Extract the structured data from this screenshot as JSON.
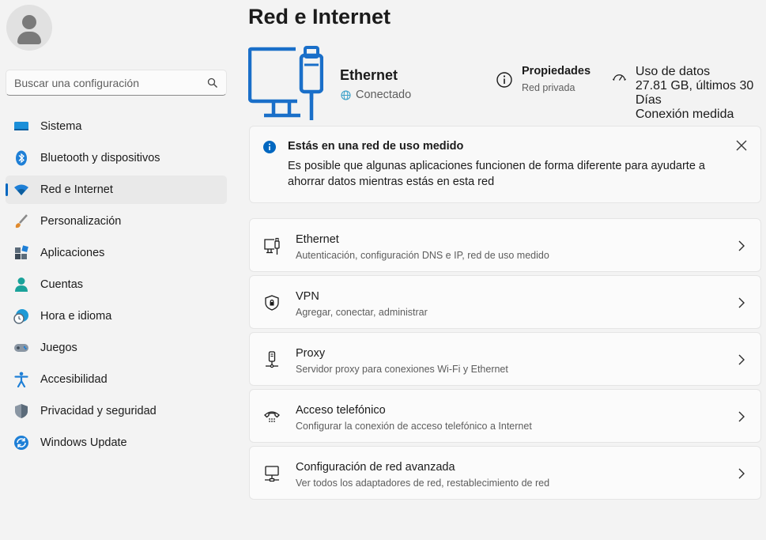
{
  "sidebar": {
    "search_placeholder": "Buscar una configuración",
    "items": [
      {
        "label": "Sistema",
        "icon": "monitor-icon"
      },
      {
        "label": "Bluetooth y dispositivos",
        "icon": "bluetooth-icon"
      },
      {
        "label": "Red e Internet",
        "icon": "wifi-icon",
        "active": true
      },
      {
        "label": "Personalización",
        "icon": "brush-icon"
      },
      {
        "label": "Aplicaciones",
        "icon": "apps-icon"
      },
      {
        "label": "Cuentas",
        "icon": "person-icon"
      },
      {
        "label": "Hora e idioma",
        "icon": "clock-globe-icon"
      },
      {
        "label": "Juegos",
        "icon": "gamepad-icon"
      },
      {
        "label": "Accesibilidad",
        "icon": "accessibility-icon"
      },
      {
        "label": "Privacidad y seguridad",
        "icon": "shield-icon"
      },
      {
        "label": "Windows Update",
        "icon": "update-icon"
      }
    ]
  },
  "main": {
    "title": "Red e Internet",
    "connection": {
      "name": "Ethernet",
      "status": "Conectado"
    },
    "properties": {
      "title": "Propiedades",
      "value": "Red privada"
    },
    "data_usage": {
      "title": "Uso de datos",
      "line1": "27.81 GB, últimos 30 Días",
      "line2": "Conexión medida"
    },
    "banner": {
      "title": "Estás en una red de uso medido",
      "body": "Es posible que algunas aplicaciones funcionen de forma diferente para ayudarte a ahorrar datos mientras estás en esta red"
    },
    "cards": [
      {
        "title": "Ethernet",
        "subtitle": "Autenticación, configuración DNS e IP, red de uso medido",
        "icon": "ethernet-icon"
      },
      {
        "title": "VPN",
        "subtitle": "Agregar, conectar, administrar",
        "icon": "vpn-shield-icon"
      },
      {
        "title": "Proxy",
        "subtitle": "Servidor proxy para conexiones Wi-Fi y Ethernet",
        "icon": "proxy-icon"
      },
      {
        "title": "Acceso telefónico",
        "subtitle": "Configurar la conexión de acceso telefónico a Internet",
        "icon": "dialup-icon"
      },
      {
        "title": "Configuración de red avanzada",
        "subtitle": "Ver todos los adaptadores de red, restablecimiento de red",
        "icon": "advanced-network-icon"
      }
    ]
  },
  "colors": {
    "accent": "#0067c0",
    "hero_blue": "#1a6fc9",
    "background": "#f3f3f3"
  }
}
